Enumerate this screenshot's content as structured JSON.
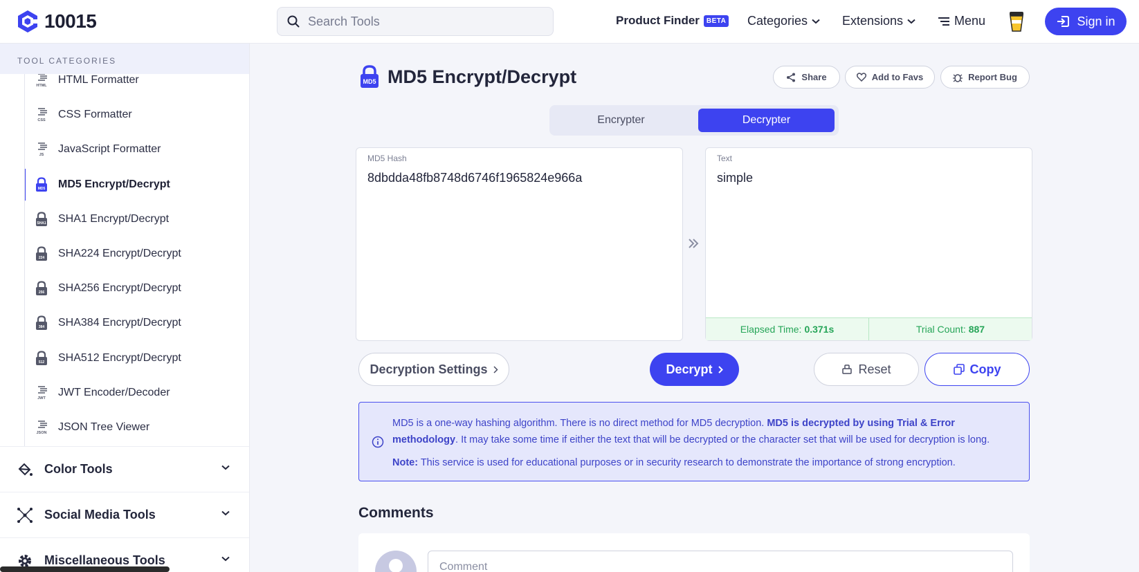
{
  "header": {
    "logo_text": "10015",
    "search_placeholder": "Search Tools",
    "nav": {
      "product_finder": "Product Finder",
      "beta_badge": "BETA",
      "categories": "Categories",
      "extensions": "Extensions",
      "menu": "Menu"
    },
    "signin_label": "Sign in"
  },
  "sidebar": {
    "heading": "TOOL CATEGORIES",
    "items": [
      {
        "label": "HTML Formatter",
        "icon_text": "HTML"
      },
      {
        "label": "CSS Formatter",
        "icon_text": "CSS"
      },
      {
        "label": "JavaScript Formatter",
        "icon_text": "JS"
      },
      {
        "label": "MD5 Encrypt/Decrypt",
        "icon_text": "MD5",
        "active": true
      },
      {
        "label": "SHA1 Encrypt/Decrypt",
        "icon_text": "SHA1"
      },
      {
        "label": "SHA224 Encrypt/Decrypt",
        "icon_text": "224"
      },
      {
        "label": "SHA256 Encrypt/Decrypt",
        "icon_text": "256"
      },
      {
        "label": "SHA384 Encrypt/Decrypt",
        "icon_text": "384"
      },
      {
        "label": "SHA512 Encrypt/Decrypt",
        "icon_text": "512"
      },
      {
        "label": "JWT Encoder/Decoder",
        "icon_text": "JWT"
      },
      {
        "label": "JSON Tree Viewer",
        "icon_text": "JSON"
      }
    ],
    "categories": [
      {
        "label": "Color Tools"
      },
      {
        "label": "Social Media Tools"
      },
      {
        "label": "Miscellaneous Tools"
      }
    ]
  },
  "main": {
    "title": "MD5 Encrypt/Decrypt",
    "title_icon_text": "MD5",
    "actions": {
      "share": "Share",
      "favs": "Add to Favs",
      "bug": "Report Bug"
    },
    "tabs": [
      {
        "label": "Encrypter"
      },
      {
        "label": "Decrypter",
        "active": true
      }
    ],
    "input": {
      "label": "MD5 Hash",
      "value": "8dbdda48fb8748d6746f1965824e966a"
    },
    "output": {
      "label": "Text",
      "value": "simple"
    },
    "stats": {
      "elapsed_label": "Elapsed Time:",
      "elapsed_value": "0.371s",
      "trial_label": "Trial Count:",
      "trial_value": "887"
    },
    "buttons": {
      "settings": "Decryption Settings",
      "decrypt": "Decrypt",
      "reset": "Reset",
      "copy": "Copy"
    },
    "info": {
      "line1_text": "MD5 is a one-way hashing algorithm. There is no direct method for MD5 decryption. ",
      "line1_bold": "MD5 is decrypted by using Trial & Error methodology",
      "line1_rest": ". It may take some time if either the text that will be decrypted or the character set that will be used for decryption is long.",
      "note_label": "Note:",
      "note_text": " This service is used for educational purposes or in security research to demonstrate the importance of strong encryption."
    },
    "comments": {
      "heading": "Comments",
      "placeholder": "Comment"
    }
  },
  "colors": {
    "accent": "#3d43f0",
    "success": "#26a558",
    "info_bg": "#e5e7fc"
  }
}
